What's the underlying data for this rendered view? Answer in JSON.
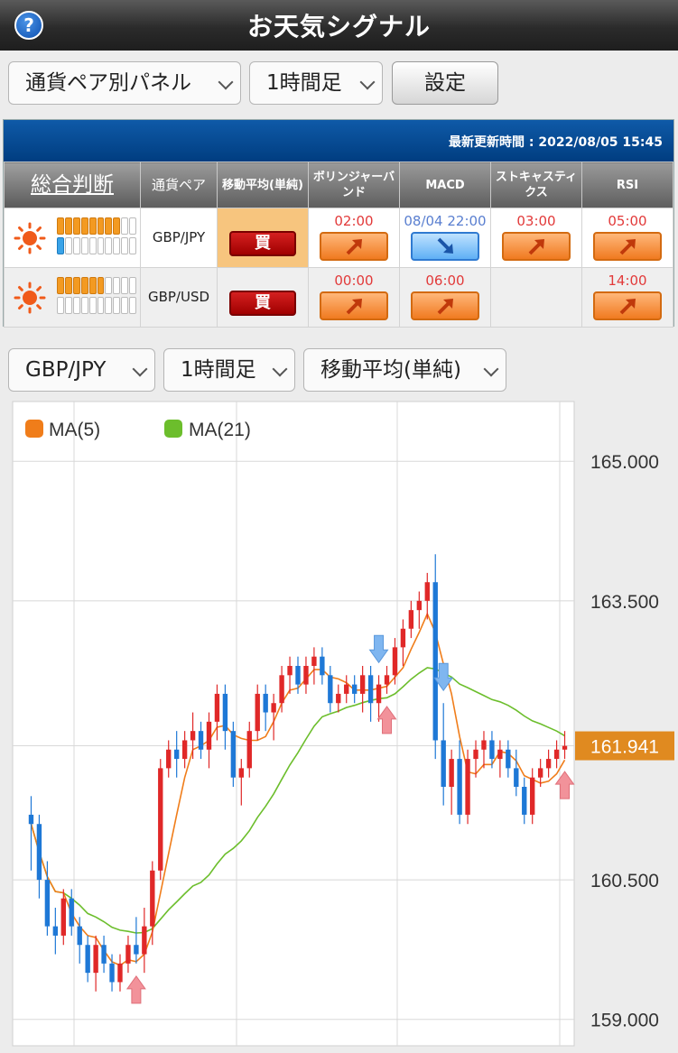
{
  "header": {
    "title": "お天気シグナル",
    "help_icon": "?"
  },
  "toolbar": {
    "panel_select": "通貨ペア別パネル",
    "timeframe_select": "1時間足",
    "settings_button": "設定"
  },
  "panel": {
    "updated": "最新更新時間 : 2022/08/05 15:45",
    "columns": [
      "総合判断",
      "通貨ペア",
      "移動平均(単純)",
      "ボリンジャーバンド",
      "MACD",
      "ストキャスティクス",
      "RSI"
    ],
    "rows": [
      {
        "weather": "sunny-icon",
        "gauge_orange": 8,
        "gauge_blue": 1,
        "pair": "GBP/JPY",
        "ma": "買",
        "bollinger": {
          "time": "02:00",
          "dir": "up"
        },
        "macd": {
          "time": "08/04 22:00",
          "dir": "down"
        },
        "stochastics": {
          "time": "03:00",
          "dir": "up"
        },
        "rsi": {
          "time": "05:00",
          "dir": "up"
        }
      },
      {
        "weather": "sunny-icon",
        "gauge_orange": 6,
        "gauge_blue": 0,
        "pair": "GBP/USD",
        "ma": "買",
        "bollinger": {
          "time": "00:00",
          "dir": "up"
        },
        "macd": {
          "time": "06:00",
          "dir": "up"
        },
        "stochastics": {
          "time": "",
          "dir": ""
        },
        "rsi": {
          "time": "14:00",
          "dir": "up"
        }
      }
    ]
  },
  "chart_controls": {
    "pair_select": "GBP/JPY",
    "timeframe_select": "1時間足",
    "indicator_select": "移動平均(単純)"
  },
  "chart_data": {
    "type": "candlestick",
    "legend": [
      {
        "name": "MA(5)",
        "color": "#f07d1a"
      },
      {
        "name": "MA(21)",
        "color": "#6cbe2c"
      }
    ],
    "y_ticks": [
      "165.000",
      "163.500",
      "160.500",
      "159.000"
    ],
    "ylim": [
      158.9,
      165.4
    ],
    "current_price": "161.941",
    "colors": {
      "up": "#e02828",
      "down": "#1e78d6",
      "price_tag": "#e08a20"
    },
    "ohlc": [
      [
        161.2,
        161.4,
        160.6,
        161.1
      ],
      [
        161.1,
        161.2,
        160.3,
        160.5
      ],
      [
        160.5,
        160.7,
        159.9,
        160.0
      ],
      [
        160.0,
        160.2,
        159.7,
        159.9
      ],
      [
        159.9,
        160.4,
        159.8,
        160.3
      ],
      [
        160.3,
        160.4,
        159.9,
        160.0
      ],
      [
        160.0,
        160.1,
        159.6,
        159.8
      ],
      [
        159.8,
        159.9,
        159.4,
        159.5
      ],
      [
        159.5,
        159.9,
        159.3,
        159.8
      ],
      [
        159.8,
        159.9,
        159.5,
        159.6
      ],
      [
        159.6,
        159.7,
        159.3,
        159.4
      ],
      [
        159.4,
        159.7,
        159.3,
        159.6
      ],
      [
        159.6,
        159.9,
        159.5,
        159.8
      ],
      [
        159.8,
        160.1,
        159.6,
        159.7
      ],
      [
        159.7,
        160.2,
        159.5,
        160.0
      ],
      [
        160.0,
        160.7,
        159.8,
        160.6
      ],
      [
        160.6,
        161.8,
        160.5,
        161.7
      ],
      [
        161.7,
        162.0,
        161.6,
        161.9
      ],
      [
        161.9,
        162.1,
        161.6,
        161.8
      ],
      [
        161.8,
        162.1,
        161.7,
        162.0
      ],
      [
        162.0,
        162.3,
        161.8,
        162.1
      ],
      [
        162.1,
        162.2,
        161.8,
        161.9
      ],
      [
        161.9,
        162.3,
        161.7,
        162.2
      ],
      [
        162.2,
        162.6,
        162.0,
        162.5
      ],
      [
        162.5,
        162.6,
        161.9,
        162.1
      ],
      [
        162.1,
        162.2,
        161.5,
        161.6
      ],
      [
        161.6,
        161.8,
        161.3,
        161.7
      ],
      [
        161.7,
        162.2,
        161.6,
        162.1
      ],
      [
        162.1,
        162.6,
        162.0,
        162.5
      ],
      [
        162.5,
        162.6,
        162.1,
        162.3
      ],
      [
        162.3,
        162.5,
        162.0,
        162.4
      ],
      [
        162.4,
        162.8,
        162.3,
        162.7
      ],
      [
        162.7,
        162.9,
        162.5,
        162.8
      ],
      [
        162.8,
        162.9,
        162.5,
        162.6
      ],
      [
        162.6,
        162.9,
        162.5,
        162.8
      ],
      [
        162.8,
        163.0,
        162.6,
        162.9
      ],
      [
        162.9,
        163.0,
        162.6,
        162.7
      ],
      [
        162.7,
        162.8,
        162.3,
        162.4
      ],
      [
        162.4,
        162.6,
        162.3,
        162.5
      ],
      [
        162.5,
        162.7,
        162.4,
        162.6
      ],
      [
        162.6,
        162.7,
        162.4,
        162.5
      ],
      [
        162.5,
        162.8,
        162.3,
        162.7
      ],
      [
        162.7,
        162.8,
        162.2,
        162.4
      ],
      [
        162.4,
        162.7,
        162.2,
        162.6
      ],
      [
        162.6,
        162.8,
        162.5,
        162.7
      ],
      [
        162.7,
        163.1,
        162.6,
        163.0
      ],
      [
        163.0,
        163.3,
        162.8,
        163.2
      ],
      [
        163.2,
        163.5,
        163.1,
        163.4
      ],
      [
        163.4,
        163.6,
        163.2,
        163.5
      ],
      [
        163.5,
        163.8,
        163.3,
        163.7
      ],
      [
        163.7,
        164.0,
        161.8,
        162.0
      ],
      [
        162.0,
        162.4,
        161.3,
        161.5
      ],
      [
        161.5,
        161.9,
        161.2,
        161.8
      ],
      [
        161.8,
        162.0,
        161.1,
        161.2
      ],
      [
        161.2,
        161.9,
        161.1,
        161.8
      ],
      [
        161.8,
        162.0,
        161.6,
        161.9
      ],
      [
        161.9,
        162.1,
        161.7,
        162.0
      ],
      [
        162.0,
        162.1,
        161.7,
        161.8
      ],
      [
        161.8,
        162.0,
        161.6,
        161.9
      ],
      [
        161.9,
        162.0,
        161.6,
        161.7
      ],
      [
        161.7,
        161.9,
        161.4,
        161.5
      ],
      [
        161.5,
        161.6,
        161.1,
        161.2
      ],
      [
        161.2,
        161.7,
        161.1,
        161.6
      ],
      [
        161.6,
        161.8,
        161.5,
        161.7
      ],
      [
        161.7,
        161.9,
        161.6,
        161.8
      ],
      [
        161.8,
        162.0,
        161.7,
        161.9
      ],
      [
        161.9,
        162.1,
        161.8,
        161.94
      ]
    ],
    "signals": [
      {
        "index": 13,
        "dir": "buy"
      },
      {
        "index": 43,
        "dir": "sell"
      },
      {
        "index": 44,
        "dir": "buy"
      },
      {
        "index": 51,
        "dir": "sell"
      },
      {
        "index": 66,
        "dir": "buy"
      }
    ]
  }
}
